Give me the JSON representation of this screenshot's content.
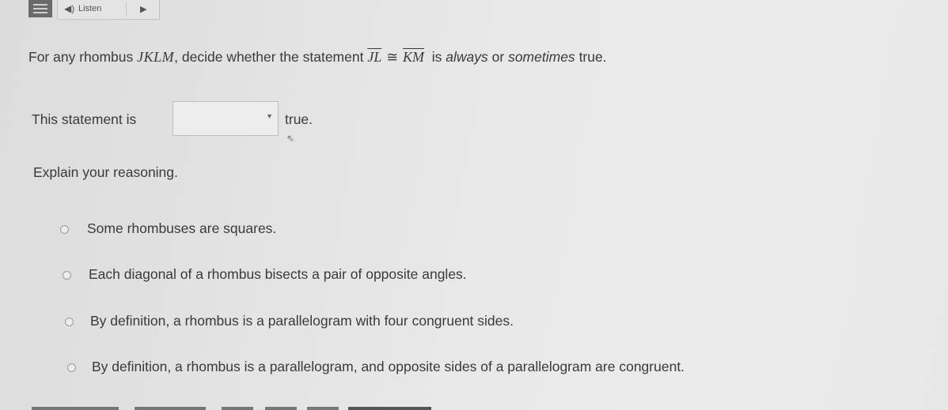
{
  "toolbar": {
    "listen_label": "Listen"
  },
  "question": {
    "prefix": "For any rhombus",
    "figure": "JKLM",
    "middle": ", decide whether the statement",
    "segment_1": "JL",
    "congruent_symbol": "≅",
    "segment_2": "KM",
    "suffix_1": "is",
    "word_always": "always",
    "word_or": "or",
    "word_sometimes": "sometimes",
    "suffix_2": "true."
  },
  "statement": {
    "before": "This statement is",
    "select_value": "",
    "after": "true."
  },
  "explain_label": "Explain your reasoning.",
  "options": [
    "Some rhombuses are squares.",
    "Each diagonal of a rhombus bisects a pair of opposite angles.",
    "By definition, a rhombus is a parallelogram with four congruent sides.",
    "By definition, a rhombus is a parallelogram, and opposite sides of a parallelogram are congruent."
  ],
  "icons": {
    "menu": "menu-icon",
    "speaker": "speaker-icon",
    "play": "play-icon",
    "chevron": "chevron-down-icon",
    "cursor": "mouse-cursor-icon",
    "radio": "radio-icon"
  }
}
